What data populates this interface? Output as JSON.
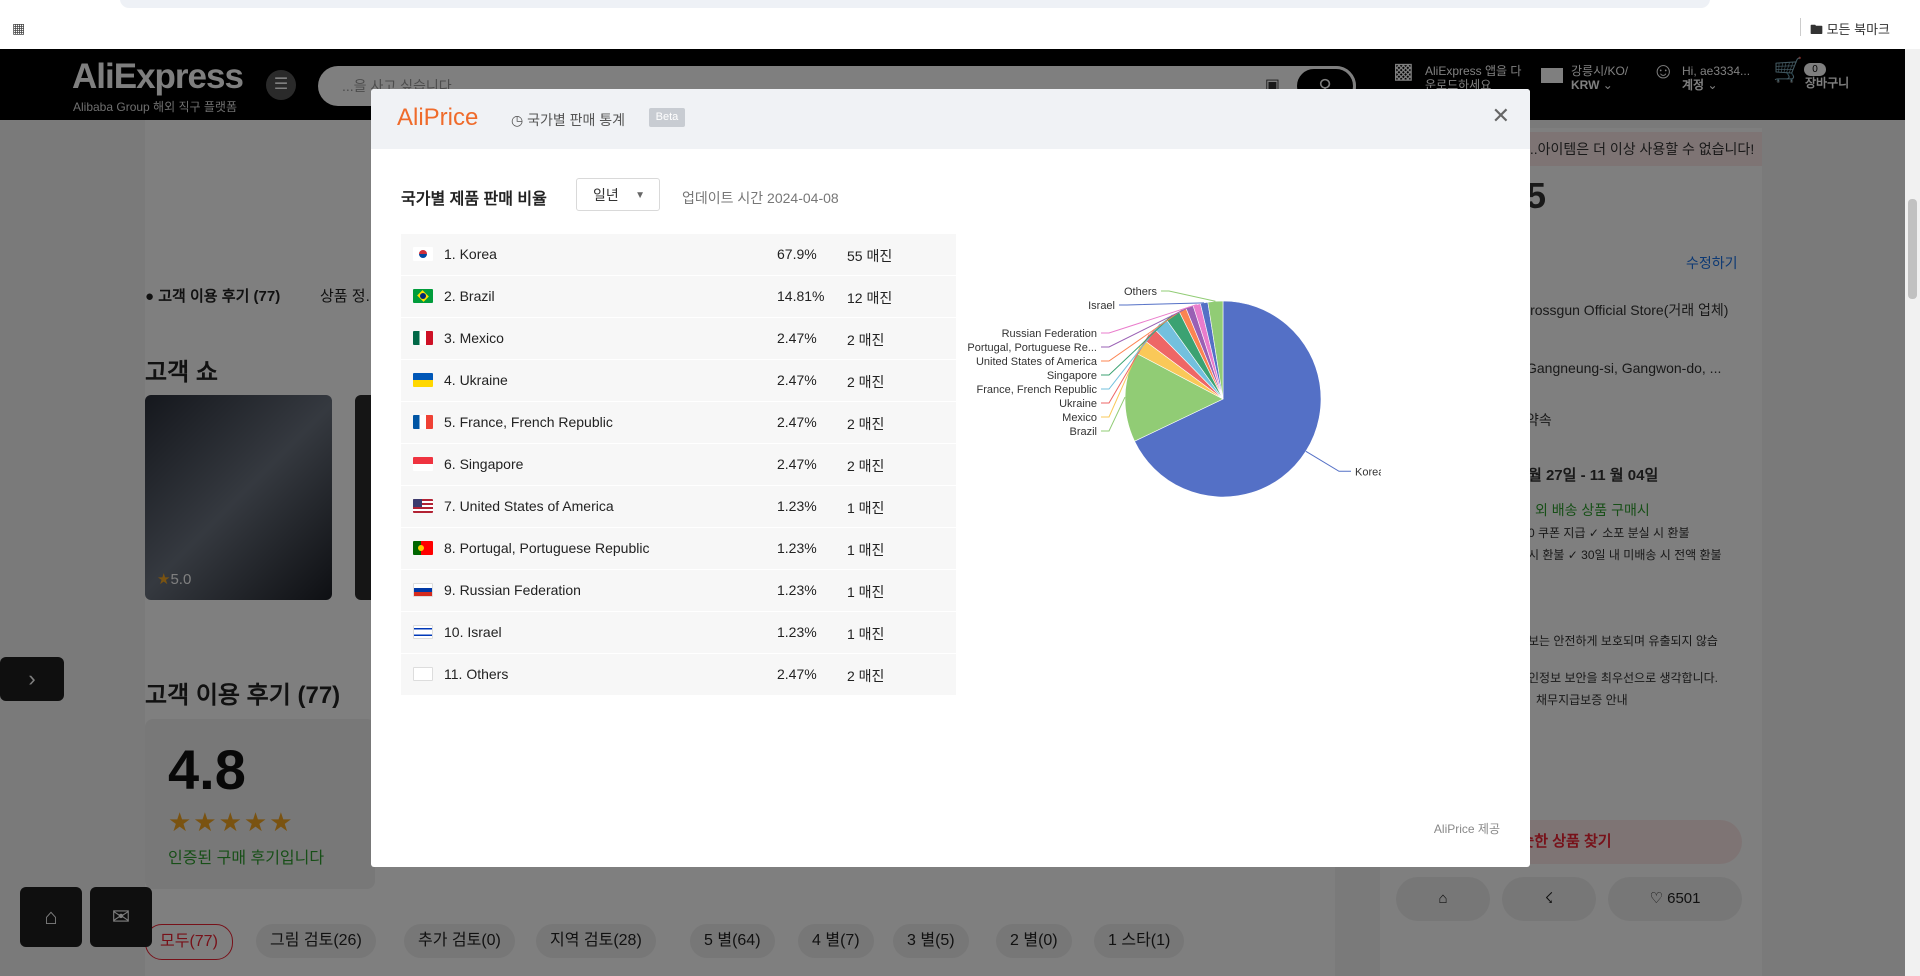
{
  "browser": {
    "apps_icon": "apps-grid-icon",
    "bookmarks_label": "모든 북마크"
  },
  "header": {
    "logo": "AliExpress",
    "logo_sub": "Alibaba Group 해외 직구 플랫폼",
    "search_placeholder": "...을 사고 싶습니다.",
    "app_line1": "AliExpress 앱을 다",
    "app_line2": "운로드하세요",
    "region_line1": "강릉시/KO/",
    "region_line2": "KRW",
    "account_line1": "Hi, ae3334...",
    "account_line2": "계정",
    "cart_count": "0",
    "cart_label": "장바구니"
  },
  "background": {
    "review_tab": "고객 이용 후기 (77)",
    "spec_tab": "상품 정...",
    "show_title": "고객 쇼",
    "show_rating": "5.0",
    "reviews_title": "고객 이용 후기 (77)",
    "rating": "4.8",
    "verified": "인증된 구매 후기입니다",
    "chips": [
      "모두(77)",
      "그림 검토(26)",
      "추가 검토(0)",
      "지역 검토(28)",
      "5 별(64)",
      "4 별(7)",
      "3 별(5)",
      "2 별(0)",
      "1 스타(1)"
    ],
    "right_warn": "...아이템은 더 이상 사용할 수 없습니다!",
    "right_price_digit": "5",
    "right_edit": "수정하기",
    "right_store": "Crossgun Official Store(거래 업체)",
    "right_address": "Gangneung-si, Gangwon-do, ...",
    "right_promise": "약속",
    "right_dates": "월 27일 - 11 월 04일",
    "right_green": "외 배송 상품 구매시",
    "right_small1": "0 쿠폰 지급 ✓ 소포 분실 시 환불",
    "right_small2": "시 환불 ✓ 30일 내 미배송 시 전액 환불",
    "right_small3": "보는 안전하게 보호되며 유출되지 않습",
    "right_small4": "인정보 보안을 최우선으로 생각합니다.",
    "right_small5": "채무지급보증 안내",
    "right_find": "숫한 상품 찾기",
    "right_likes": "6501"
  },
  "modal": {
    "brand": "AliPrice",
    "tab_label": "국가별 판매 통계",
    "beta": "Beta",
    "section_title": "국가별 제품 판매 비율",
    "period_value": "일년",
    "updated_label": "업데이트 시간 2024-04-08",
    "credit": "AliPrice 제공",
    "rows": [
      {
        "name": "1. Korea",
        "pct": "67.9%",
        "count": "55 매진"
      },
      {
        "name": "2. Brazil",
        "pct": "14.81%",
        "count": "12 매진"
      },
      {
        "name": "3. Mexico",
        "pct": "2.47%",
        "count": "2 매진"
      },
      {
        "name": "4. Ukraine",
        "pct": "2.47%",
        "count": "2 매진"
      },
      {
        "name": "5. France, French Republic",
        "pct": "2.47%",
        "count": "2 매진"
      },
      {
        "name": "6. Singapore",
        "pct": "2.47%",
        "count": "2 매진"
      },
      {
        "name": "7. United States of America",
        "pct": "1.23%",
        "count": "1 매진"
      },
      {
        "name": "8. Portugal, Portuguese Republic",
        "pct": "1.23%",
        "count": "1 매진"
      },
      {
        "name": "9. Russian Federation",
        "pct": "1.23%",
        "count": "1 매진"
      },
      {
        "name": "10. Israel",
        "pct": "1.23%",
        "count": "1 매진"
      },
      {
        "name": "11. Others",
        "pct": "2.47%",
        "count": "2 매진"
      }
    ]
  },
  "chart_data": {
    "type": "pie",
    "categories": [
      "Korea",
      "Brazil",
      "Mexico",
      "Ukraine",
      "France, French Republic",
      "Singapore",
      "United States of America",
      "Portugal, Portuguese Re...",
      "Russian Federation",
      "Israel",
      "Others"
    ],
    "values": [
      67.9,
      14.81,
      2.47,
      2.47,
      2.47,
      2.47,
      1.23,
      1.23,
      1.23,
      1.23,
      2.47
    ],
    "colors": [
      "#5470c6",
      "#91cc75",
      "#fac858",
      "#ee6666",
      "#73c0de",
      "#3ba272",
      "#fc8452",
      "#9a60b4",
      "#ea7ccc",
      "#5470c6",
      "#91cc75"
    ]
  }
}
